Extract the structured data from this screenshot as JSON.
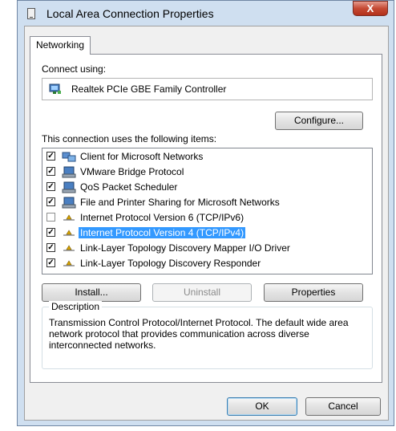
{
  "window": {
    "title": "Local Area Connection Properties",
    "close_label": "X"
  },
  "tabs": [
    {
      "label": "Networking"
    }
  ],
  "connect_using": {
    "label": "Connect using:",
    "adapter": "Realtek PCIe GBE Family Controller",
    "configure_button": "Configure..."
  },
  "items_section": {
    "label": "This connection uses the following items:",
    "items": [
      {
        "label": "Client for Microsoft Networks",
        "checked": true,
        "icon": "network-client-icon"
      },
      {
        "label": "VMware Bridge Protocol",
        "checked": true,
        "icon": "network-service-icon"
      },
      {
        "label": "QoS Packet Scheduler",
        "checked": true,
        "icon": "network-service-icon"
      },
      {
        "label": "File and Printer Sharing for Microsoft Networks",
        "checked": true,
        "icon": "network-service-icon"
      },
      {
        "label": "Internet Protocol Version 6 (TCP/IPv6)",
        "checked": false,
        "icon": "protocol-icon"
      },
      {
        "label": "Internet Protocol Version 4 (TCP/IPv4)",
        "checked": true,
        "icon": "protocol-icon",
        "selected": true
      },
      {
        "label": "Link-Layer Topology Discovery Mapper I/O Driver",
        "checked": true,
        "icon": "protocol-icon"
      },
      {
        "label": "Link-Layer Topology Discovery Responder",
        "checked": true,
        "icon": "protocol-icon"
      }
    ]
  },
  "buttons": {
    "install": "Install...",
    "uninstall": "Uninstall",
    "properties": "Properties"
  },
  "description": {
    "legend": "Description",
    "text": "Transmission Control Protocol/Internet Protocol. The default wide area network protocol that provides communication across diverse interconnected networks."
  },
  "footer": {
    "ok": "OK",
    "cancel": "Cancel"
  },
  "colors": {
    "selection": "#3399ff",
    "titlebar": "#cfdff0",
    "close": "#c54a34"
  }
}
